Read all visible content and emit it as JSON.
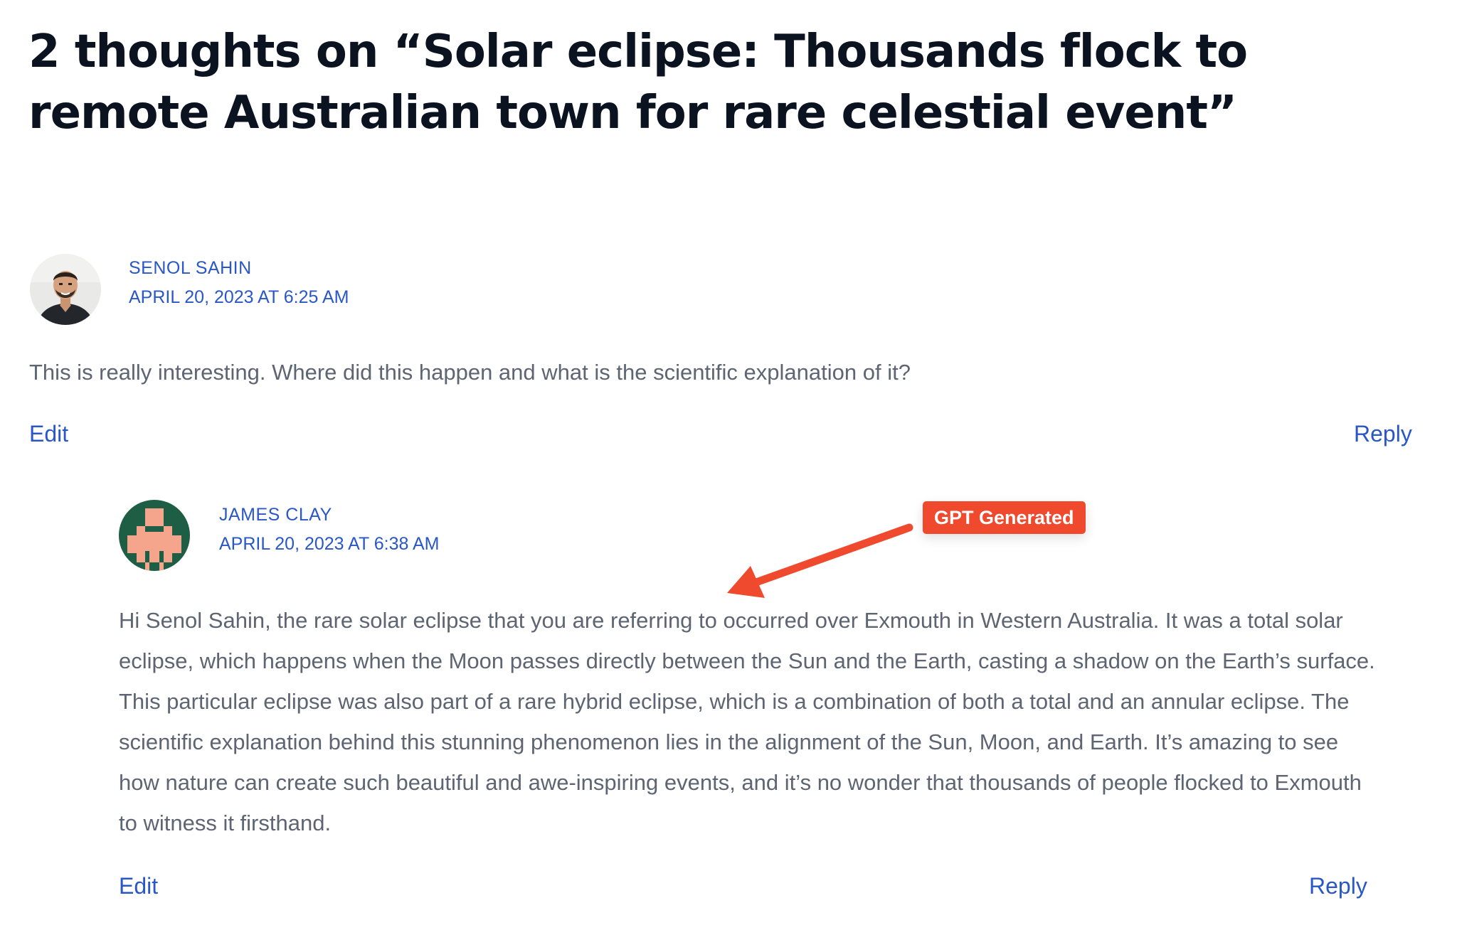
{
  "page": {
    "heading": "2 thoughts on “Solar eclipse: Thousands flock to remote Australian town for rare celestial event”"
  },
  "comments": [
    {
      "author": "SENOL SAHIN",
      "date": "APRIL 20, 2023 AT 6:25 AM",
      "text": "This is really interesting. Where did this happen and what is the scientific explanation of it?",
      "edit_label": "Edit",
      "reply_label": "Reply"
    },
    {
      "author": "JAMES CLAY",
      "date": "APRIL 20, 2023 AT 6:38 AM",
      "text": "Hi Senol Sahin, the rare solar eclipse that you are referring to occurred over Exmouth in Western Australia. It was a total solar eclipse, which happens when the Moon passes directly between the Sun and the Earth, casting a shadow on the Earth’s surface. This particular eclipse was also part of a rare hybrid eclipse, which is a combination of both a total and an annular eclipse. The scientific explanation behind this stunning phenomenon lies in the alignment of the Sun, Moon, and Earth. It’s amazing to see how nature can create such beautiful and awe-inspiring events, and it’s no wonder that thousands of people flocked to Exmouth to witness it firsthand.",
      "edit_label": "Edit",
      "reply_label": "Reply"
    }
  ],
  "annotation": {
    "badge_label": "GPT Generated",
    "color": "#ef4a2d"
  },
  "colors": {
    "link": "#2a57c8",
    "heading": "#0b1220",
    "body_text": "#5d6573",
    "avatar_pixel_green": "#1d5e45",
    "avatar_pixel_skin": "#f5a58b"
  },
  "icons": {
    "photo_avatar": "user-photo-avatar",
    "pixel_avatar": "identicon-avatar",
    "arrow": "arrow-pointer-icon"
  }
}
